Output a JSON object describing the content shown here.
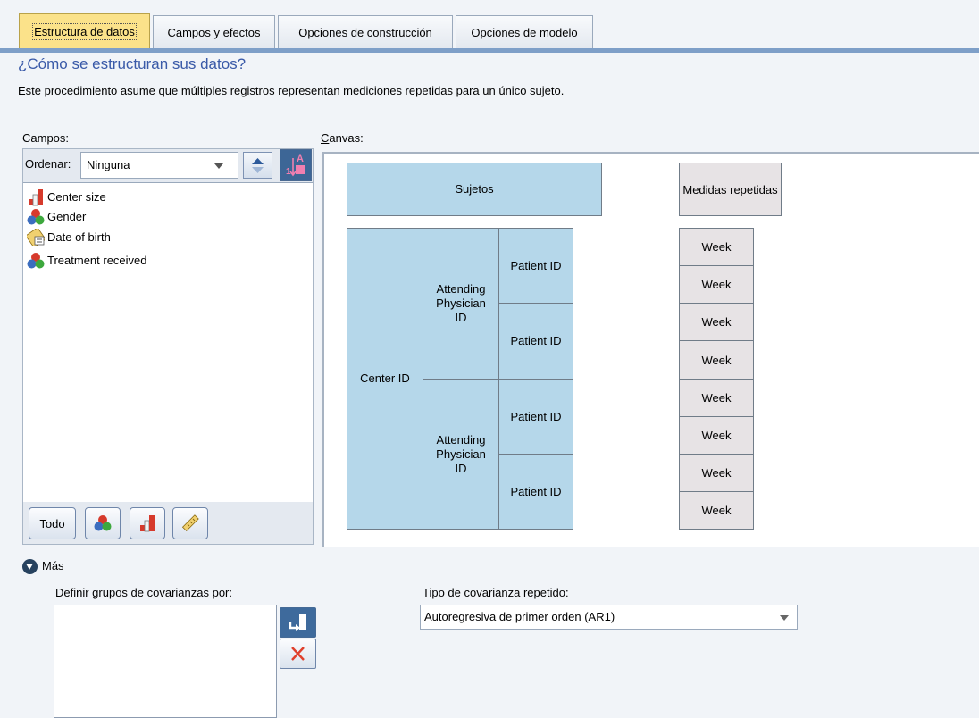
{
  "tabs": [
    {
      "label": "Estructura de datos",
      "active": true
    },
    {
      "label": "Campos y efectos",
      "active": false
    },
    {
      "label": "Opciones de construcción",
      "active": false
    },
    {
      "label": "Opciones de modelo",
      "active": false
    }
  ],
  "header": {
    "question": "¿Cómo se estructuran sus datos?",
    "description": "Este procedimiento asume que múltiples registros representan mediciones repetidas para un único sujeto."
  },
  "fields": {
    "label": "Campos:",
    "sort_label": "Ordenar:",
    "sort_value": "Ninguna",
    "items": [
      {
        "label": "Center size",
        "icon": "ordinal-icon"
      },
      {
        "label": "Gender",
        "icon": "nominal-icon"
      },
      {
        "label": "Date of birth",
        "icon": "date-icon"
      },
      {
        "label": "Treatment received",
        "icon": "nominal-icon"
      }
    ],
    "buttons": {
      "all": "Todo"
    }
  },
  "canvas": {
    "label": "Canvas:",
    "subjects_header": "Sujetos",
    "repeated_header": "Medidas repetidas",
    "center": "Center ID",
    "physician": "Attending Physician ID",
    "patient": "Patient ID",
    "week": "Week"
  },
  "more": {
    "label": "Más",
    "cov_groups_label": "Definir grupos de covarianzas por:",
    "rep_cov_label": "Tipo de covarianza repetido:",
    "rep_cov_value": "Autoregresiva de primer orden (AR1)"
  },
  "colors": {
    "accent": "#7e9fc8",
    "active_tab": "#fbe28a",
    "subject_box": "#b5d7ea",
    "repeated_box": "#e7e3e5",
    "question_text": "#3a5aa8"
  }
}
